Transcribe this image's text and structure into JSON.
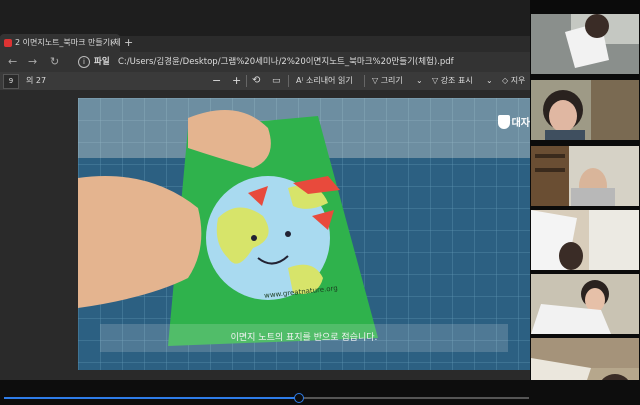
{
  "browser": {
    "tab": {
      "title": "2 이면지노트_북마크 만들기(체)",
      "close": "×"
    },
    "new_tab": "+",
    "nav": {
      "back": "←",
      "forward": "→",
      "reload": "↻"
    },
    "address": {
      "info_icon": "i",
      "scheme": "파일",
      "url": "C:/Users/김경윤/Desktop/그램%20세미나/2%20이면지노트_북마크%20만들기(체험).pdf"
    }
  },
  "pdf_toolbar": {
    "page_number": "9",
    "page_total": "의 27",
    "zoom_out": "−",
    "zoom_in": "+",
    "read_aloud": "A⁾ 소리내어 읽기",
    "draw": "▽ 그리기",
    "highlight": "▽ 강조 표시",
    "erase": "◇ 지우"
  },
  "video": {
    "subtitle": "이면지 노트의 표지를 반으로 접습니다.",
    "watermark": "대자",
    "card_url": "www.greatnature.org",
    "progress": 0.56
  }
}
